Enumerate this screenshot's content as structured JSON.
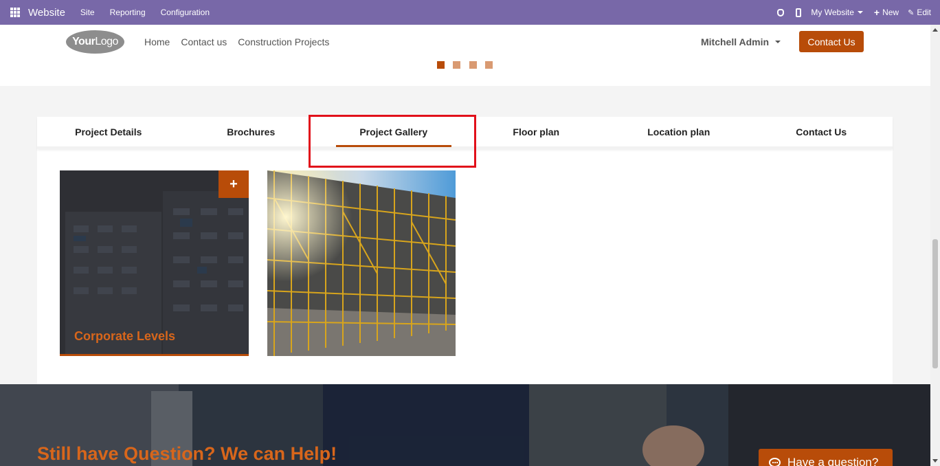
{
  "topbar": {
    "app_name": "Website",
    "menus": [
      "Site",
      "Reporting",
      "Configuration"
    ],
    "website_selector": "My Website",
    "new_label": "New",
    "edit_label": "Edit"
  },
  "header": {
    "logo_text_bold": "Your",
    "logo_text_light": "Logo",
    "nav": [
      "Home",
      "Contact us",
      "Construction Projects"
    ],
    "user_name": "Mitchell Admin",
    "cta_label": "Contact Us"
  },
  "carousel": {
    "indicator_count": 4,
    "active_index": 0
  },
  "tabs": {
    "items": [
      "Project Details",
      "Brochures",
      "Project Gallery",
      "Floor plan",
      "Location plan",
      "Contact Us"
    ],
    "active": "Project Gallery"
  },
  "gallery": {
    "items": [
      {
        "caption": "Corporate Levels",
        "action": "+"
      },
      {
        "caption": ""
      }
    ]
  },
  "banner": {
    "title": "Still have Question? We can Help!",
    "question_button": "Have a question?"
  },
  "colors": {
    "odoo_bar": "#7868a8",
    "accent": "#b84c09",
    "accent_text": "#d8661b",
    "highlight": "#e1101a"
  }
}
